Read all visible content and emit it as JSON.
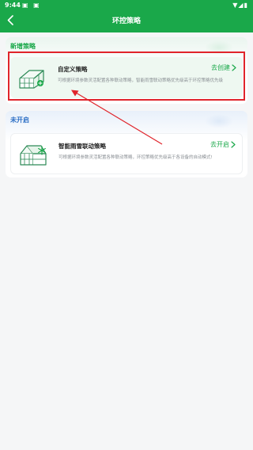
{
  "status_bar": {
    "time": "9:44"
  },
  "header": {
    "title": "环控策略"
  },
  "sections": [
    {
      "title": "新增策略",
      "card": {
        "title": "自定义策略",
        "description": "可根据环境参数灵活配置各种联动策略，智能雨雪联动策略优先级高于环控策略优先级",
        "action": "去创建",
        "icon": "greenhouse-icon"
      }
    },
    {
      "title": "未开启",
      "card": {
        "title": "智能雨雪联动策略",
        "description": "可根据环境参数灵活配置各种联动策略，环控策略优先级高于各设备的自动模式!",
        "action": "去开启",
        "icon": "greenhouse-snow-icon"
      }
    }
  ],
  "colors": {
    "brand_green": "#1aa84a",
    "section_blue": "#2d6fc5",
    "annotation_red": "#e0242b"
  }
}
